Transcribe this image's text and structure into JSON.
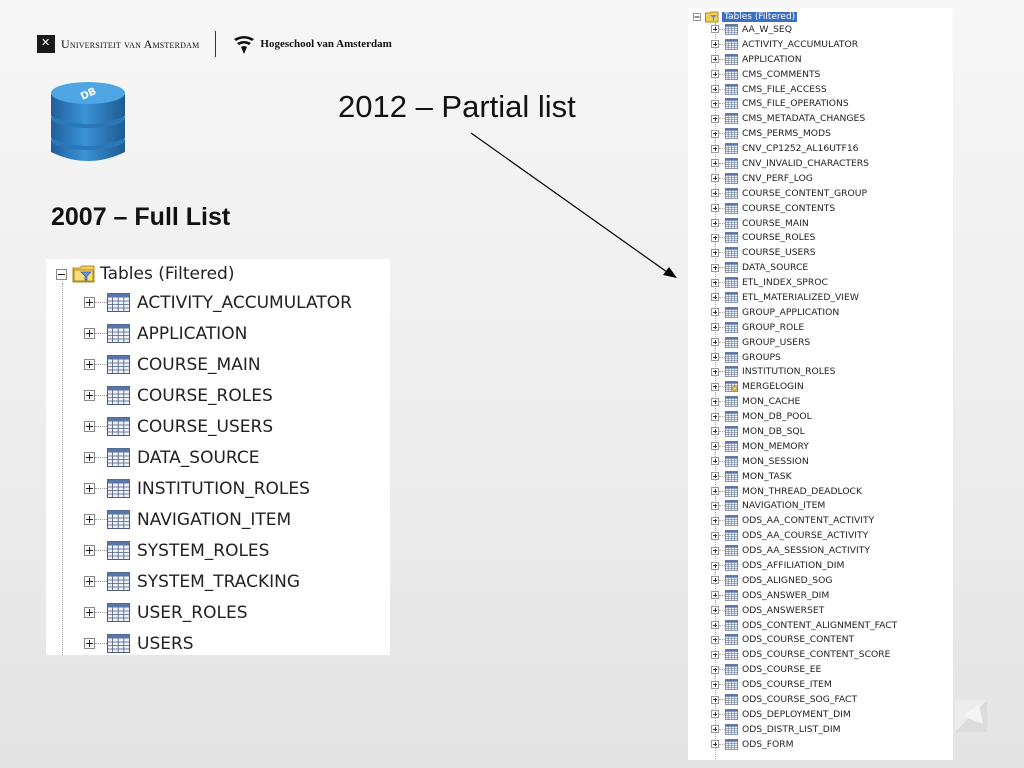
{
  "header": {
    "uva_name": "Universiteit van Amsterdam",
    "hva_name": "Hogeschool van Amsterdam",
    "db_badge": "DB"
  },
  "titles": {
    "right": "2012 – Partial list",
    "left": "2007 – Full List"
  },
  "tree_2007": {
    "root_label": "Tables (Filtered)",
    "items": [
      "ACTIVITY_ACCUMULATOR",
      "APPLICATION",
      "COURSE_MAIN",
      "COURSE_ROLES",
      "COURSE_USERS",
      "DATA_SOURCE",
      "INSTITUTION_ROLES",
      "NAVIGATION_ITEM",
      "SYSTEM_ROLES",
      "SYSTEM_TRACKING",
      "USER_ROLES",
      "USERS"
    ]
  },
  "tree_2012": {
    "root_label": "Tables (Filtered)",
    "items": [
      "AA_W_SEQ",
      "ACTIVITY_ACCUMULATOR",
      "APPLICATION",
      "CMS_COMMENTS",
      "CMS_FILE_ACCESS",
      "CMS_FILE_OPERATIONS",
      "CMS_METADATA_CHANGES",
      "CMS_PERMS_MODS",
      "CNV_CP1252_AL16UTF16",
      "CNV_INVALID_CHARACTERS",
      "CNV_PERF_LOG",
      "COURSE_CONTENT_GROUP",
      "COURSE_CONTENTS",
      "COURSE_MAIN",
      "COURSE_ROLES",
      "COURSE_USERS",
      "DATA_SOURCE",
      "ETL_INDEX_SPROC",
      "ETL_MATERIALIZED_VIEW",
      "GROUP_APPLICATION",
      "GROUP_ROLE",
      "GROUP_USERS",
      "GROUPS",
      "INSTITUTION_ROLES",
      "MERGELOGIN",
      "MON_CACHE",
      "MON_DB_POOL",
      "MON_DB_SQL",
      "MON_MEMORY",
      "MON_SESSION",
      "MON_TASK",
      "MON_THREAD_DEADLOCK",
      "NAVIGATION_ITEM",
      "ODS_AA_CONTENT_ACTIVITY",
      "ODS_AA_COURSE_ACTIVITY",
      "ODS_AA_SESSION_ACTIVITY",
      "ODS_AFFILIATION_DIM",
      "ODS_ALIGNED_SOG",
      "ODS_ANSWER_DIM",
      "ODS_ANSWERSET",
      "ODS_CONTENT_ALIGNMENT_FACT",
      "ODS_COURSE_CONTENT",
      "ODS_COURSE_CONTENT_SCORE",
      "ODS_COURSE_EE",
      "ODS_COURSE_ITEM",
      "ODS_COURSE_SOG_FACT",
      "ODS_DEPLOYMENT_DIM",
      "ODS_DISTR_LIST_DIM",
      "ODS_FORM"
    ],
    "view_items": [
      "MERGELOGIN"
    ]
  },
  "colors": {
    "selection": "#3b6fc4",
    "db_blue": "#2f7fc1",
    "arrow": "#000000"
  }
}
